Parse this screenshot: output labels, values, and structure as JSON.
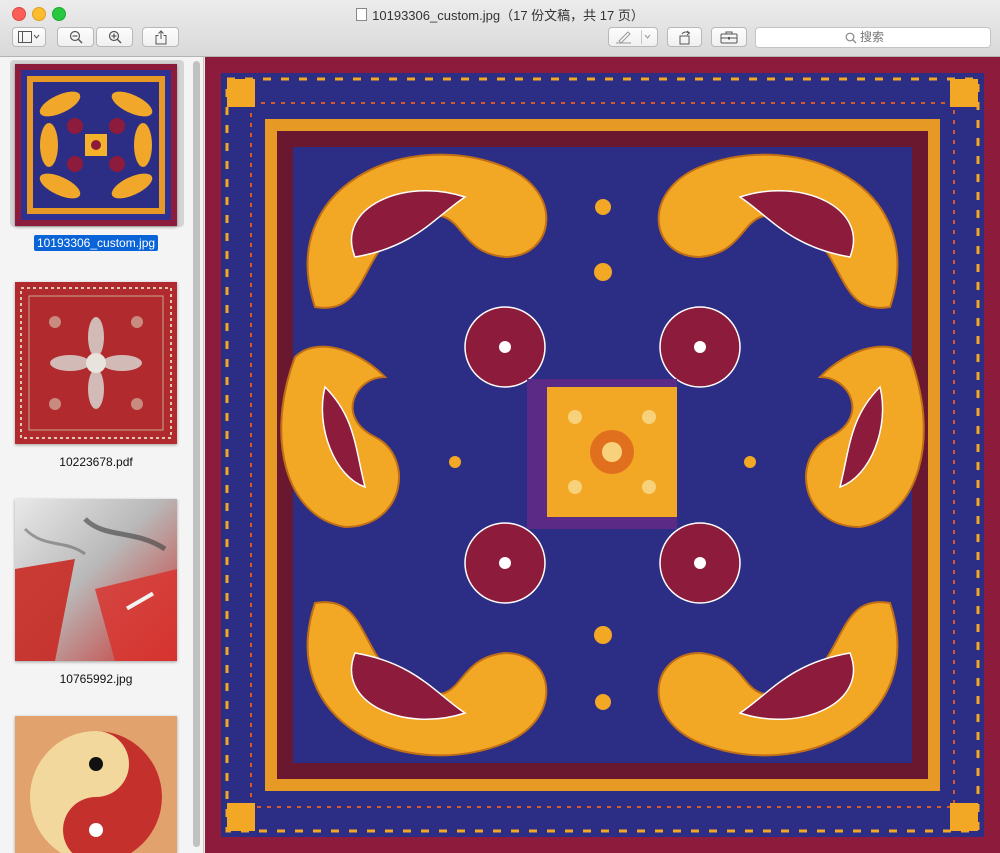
{
  "window": {
    "title": "10193306_custom.jpg（17 份文稿，共 17 页）"
  },
  "toolbar": {
    "buttons": [
      {
        "name": "sidebar-toggle",
        "icon": "sidebar-icon"
      },
      {
        "name": "zoom-out",
        "icon": "zoom-out-icon"
      },
      {
        "name": "zoom-in",
        "icon": "zoom-in-icon"
      },
      {
        "name": "share",
        "icon": "share-icon"
      },
      {
        "name": "markup",
        "icon": "pen-icon"
      },
      {
        "name": "rotate",
        "icon": "rotate-icon"
      },
      {
        "name": "toolbox",
        "icon": "toolbox-icon"
      }
    ],
    "search_placeholder": "搜索"
  },
  "sidebar": {
    "items": [
      {
        "label": "10193306_custom.jpg",
        "selected": true
      },
      {
        "label": "10223678.pdf",
        "selected": false
      },
      {
        "label": "10765992.jpg",
        "selected": false
      },
      {
        "label": "",
        "selected": false
      }
    ]
  },
  "colors": {
    "accent": "#0a64d8",
    "bandana_maroon": "#8c1b3c",
    "bandana_navy": "#2b2e84",
    "bandana_gold": "#f2a725"
  }
}
